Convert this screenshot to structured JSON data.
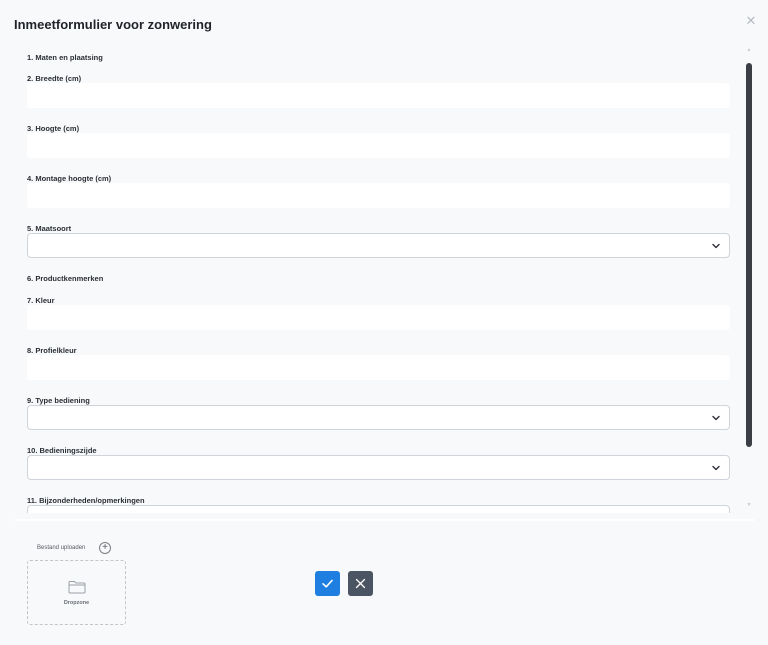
{
  "modal": {
    "title": "Inmeetformulier voor zonwering",
    "close_icon": "close-icon"
  },
  "form": {
    "section_1": "1. Maten en plaatsing",
    "breedte_label": "2. Breedte (cm)",
    "breedte_value": "",
    "hoogte_label": "3. Hoogte (cm)",
    "hoogte_value": "",
    "montage_label": "4. Montage hoogte (cm)",
    "montage_value": "",
    "maatsoort_label": "5. Maatsoort",
    "maatsoort_value": "",
    "section_6": "6. Productkenmerken",
    "kleur_label": "7. Kleur",
    "kleur_value": "",
    "profielkleur_label": "8. Profielkleur",
    "profielkleur_value": "",
    "bediening_label": "9. Type bediening",
    "bediening_value": "",
    "bedieningszijde_label": "10. Bedieningszijde",
    "bedieningszijde_value": "",
    "bijzonderheden_label": "11. Bijzonderheden/opmerkingen",
    "bijzonderheden_value": ""
  },
  "upload": {
    "label": "Bestand uploaden",
    "plus_icon": "plus-circle-icon",
    "dropzone_label": "Dropzone",
    "folder_icon": "folder-icon"
  },
  "actions": {
    "confirm_icon": "check-icon",
    "cancel_icon": "x-icon"
  },
  "colors": {
    "primary": "#1e7fe0",
    "secondary": "#4a5462",
    "background": "#f8f9fa"
  }
}
